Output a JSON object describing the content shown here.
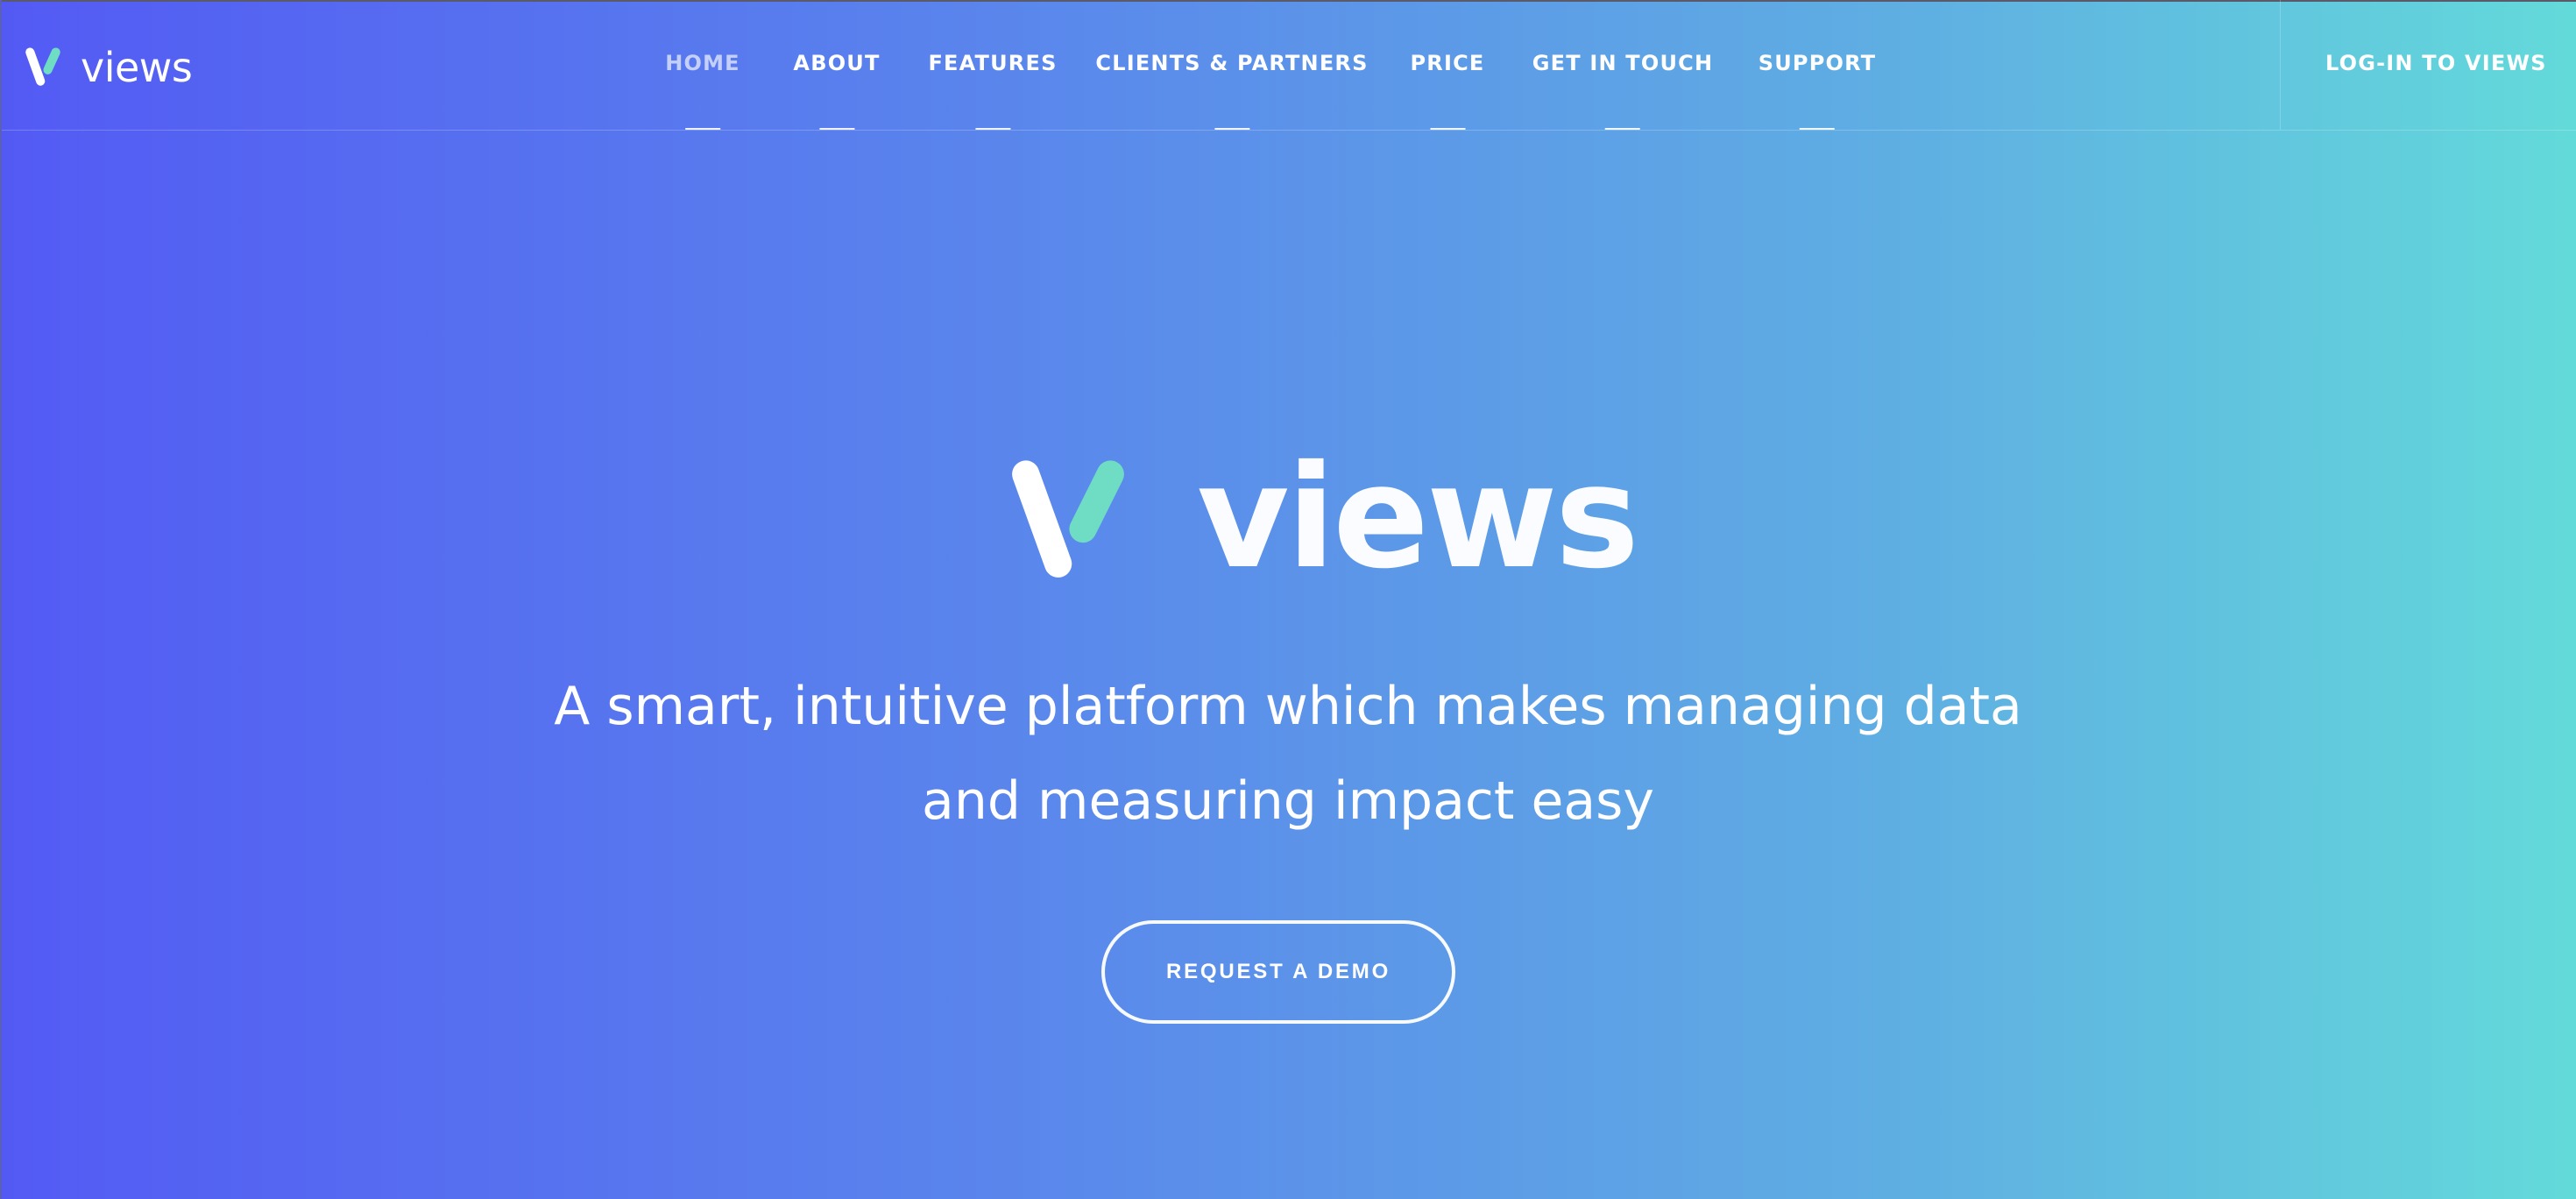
{
  "header": {
    "brand_name": "views",
    "logo_icon": "views-v-logo-icon",
    "nav": [
      {
        "label": "HOME",
        "active": true
      },
      {
        "label": "ABOUT",
        "active": false
      },
      {
        "label": "FEATURES",
        "active": false
      },
      {
        "label": "CLIENTS & PARTNERS",
        "active": false
      },
      {
        "label": "PRICE",
        "active": false
      },
      {
        "label": "GET IN TOUCH",
        "active": false
      },
      {
        "label": "SUPPORT",
        "active": false
      }
    ],
    "login_label": "LOG-IN TO VIEWS"
  },
  "hero": {
    "brand_name": "views",
    "tagline_line1": "A smart, intuitive platform which makes managing data",
    "tagline_line2": "and measuring impact easy",
    "cta_label": "REQUEST A DEMO"
  },
  "colors": {
    "gradient_start": "#535af4",
    "gradient_end": "#63dada",
    "logo_accent": "#6fdcc4",
    "text": "#ffffff"
  }
}
